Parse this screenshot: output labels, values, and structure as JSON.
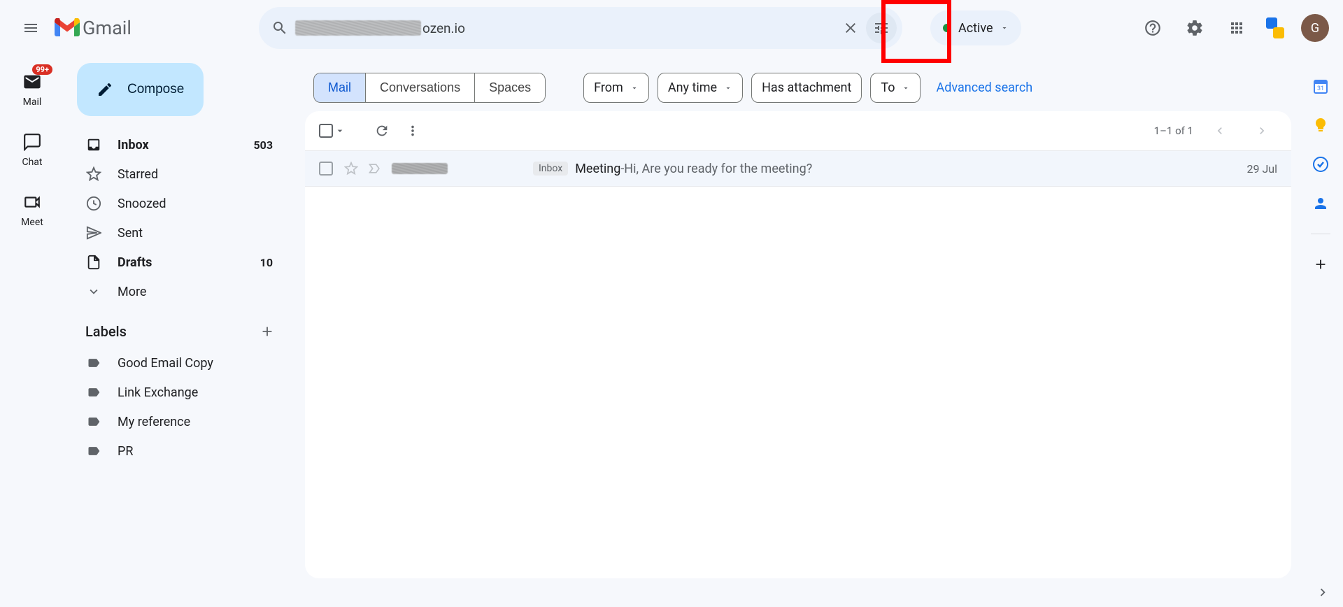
{
  "header": {
    "app_name": "Gmail",
    "search_suffix": "ozen.io",
    "status_label": "Active",
    "avatar_initial": "G"
  },
  "rail": {
    "mail_label": "Mail",
    "mail_badge": "99+",
    "chat_label": "Chat",
    "meet_label": "Meet"
  },
  "sidebar": {
    "compose_label": "Compose",
    "items": [
      {
        "label": "Inbox",
        "count": "503",
        "bold": true
      },
      {
        "label": "Starred",
        "count": ""
      },
      {
        "label": "Snoozed",
        "count": ""
      },
      {
        "label": "Sent",
        "count": ""
      },
      {
        "label": "Drafts",
        "count": "10",
        "bold": true
      },
      {
        "label": "More",
        "count": ""
      }
    ],
    "labels_title": "Labels",
    "labels": [
      {
        "label": "Good Email Copy"
      },
      {
        "label": "Link Exchange"
      },
      {
        "label": "My reference"
      },
      {
        "label": "PR"
      }
    ]
  },
  "filters": {
    "segments": [
      "Mail",
      "Conversations",
      "Spaces"
    ],
    "from": "From",
    "any_time": "Any time",
    "has_attachment": "Has attachment",
    "to": "To",
    "advanced": "Advanced search"
  },
  "toolbar": {
    "count_text": "1–1 of 1"
  },
  "email": {
    "inbox_tag": "Inbox",
    "subject": "Meeting",
    "sep": " - ",
    "snippet": "Hi, Are you ready for the meeting?",
    "date": "29 Jul"
  }
}
